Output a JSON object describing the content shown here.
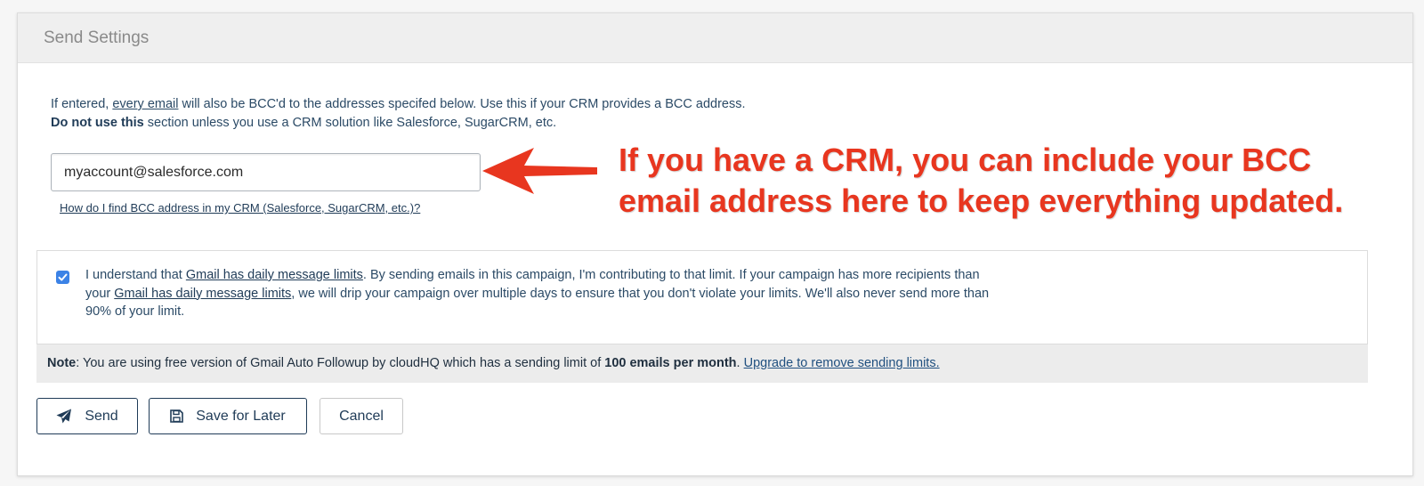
{
  "panel": {
    "title": "Send Settings"
  },
  "intro": {
    "line1_pre": "If entered, ",
    "line1_link": "every email",
    "line1_post": " will also be BCC'd to the addresses specifed below. Use this if your CRM provides a BCC address.",
    "line2_bold": "Do not use this",
    "line2_post": " section unless you use a CRM solution like Salesforce, SugarCRM, etc."
  },
  "bcc": {
    "value": "myaccount@salesforce.com",
    "help_link": "How do I find BCC address in my CRM (Salesforce, SugarCRM, etc.)?"
  },
  "annotation": {
    "line1": "If you have a CRM, you can include your BCC",
    "line2": "email address here to keep everything updated.",
    "color": "#e8361f"
  },
  "limits": {
    "checked": true,
    "l1_pre": "I understand that ",
    "l1_link": "Gmail has daily message limits",
    "l1_post": ". By sending emails in this campaign, I'm contributing to that limit. If your campaign has more recipients than",
    "l2_pre": "your ",
    "l2_link": "Gmail has daily message limits",
    "l2_post": ", we will drip your campaign over multiple days to ensure that you don't violate your limits. We'll also never send more than",
    "l3": "90% of your limit."
  },
  "note": {
    "label": "Note",
    "pre": ": You are using free version of Gmail Auto Followup by cloudHQ which has a sending limit of ",
    "bold": "100 emails per month",
    "mid": ". ",
    "link": "Upgrade to remove sending limits."
  },
  "buttons": {
    "send": "Send",
    "save": "Save for Later",
    "cancel": "Cancel"
  },
  "icons": {
    "send": "paper-plane-icon",
    "save": "floppy-disk-icon",
    "checkbox": "check-icon"
  }
}
